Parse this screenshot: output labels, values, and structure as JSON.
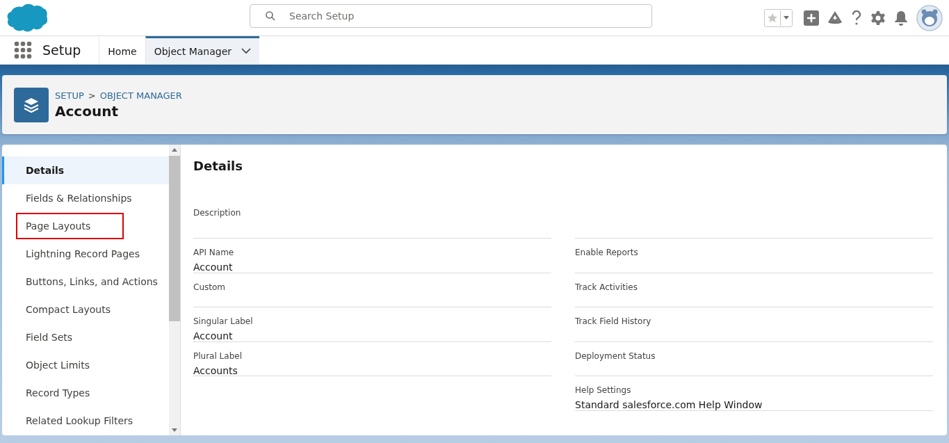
{
  "header": {
    "search": {
      "placeholder": "Search Setup"
    }
  },
  "nav": {
    "app_name": "Setup",
    "tabs": [
      {
        "label": "Home",
        "selected": false,
        "has_menu": false
      },
      {
        "label": "Object Manager",
        "selected": true,
        "has_menu": true
      }
    ]
  },
  "page_header": {
    "breadcrumb": [
      "SETUP",
      "OBJECT MANAGER"
    ],
    "separator": ">",
    "title": "Account"
  },
  "sidebar": {
    "items": [
      {
        "label": "Details",
        "selected": true,
        "highlighted": false
      },
      {
        "label": "Fields & Relationships",
        "selected": false,
        "highlighted": false
      },
      {
        "label": "Page Layouts",
        "selected": false,
        "highlighted": true
      },
      {
        "label": "Lightning Record Pages",
        "selected": false,
        "highlighted": false
      },
      {
        "label": "Buttons, Links, and Actions",
        "selected": false,
        "highlighted": false
      },
      {
        "label": "Compact Layouts",
        "selected": false,
        "highlighted": false
      },
      {
        "label": "Field Sets",
        "selected": false,
        "highlighted": false
      },
      {
        "label": "Object Limits",
        "selected": false,
        "highlighted": false
      },
      {
        "label": "Record Types",
        "selected": false,
        "highlighted": false
      },
      {
        "label": "Related Lookup Filters",
        "selected": false,
        "highlighted": false
      }
    ]
  },
  "details": {
    "title": "Details",
    "rows": [
      {
        "left": {
          "label": "Description"
        },
        "right": null
      },
      {
        "left": {
          "label": "API Name",
          "value": "Account"
        },
        "right": {
          "label": "Enable Reports"
        }
      },
      {
        "left": {
          "label": "Custom"
        },
        "right": {
          "label": "Track Activities"
        }
      },
      {
        "left": {
          "label": "Singular Label",
          "value": "Account"
        },
        "right": {
          "label": "Track Field History"
        }
      },
      {
        "left": {
          "label": "Plural Label",
          "value": "Accounts"
        },
        "right": {
          "label": "Deployment Status"
        }
      },
      {
        "left": null,
        "right": {
          "label": "Help Settings",
          "value": "Standard salesforce.com Help Window"
        }
      }
    ]
  }
}
